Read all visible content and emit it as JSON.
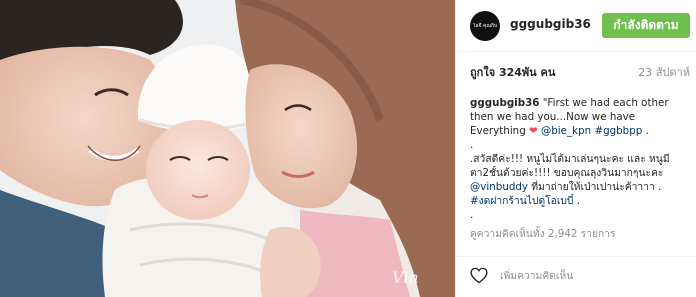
{
  "photo": {
    "alt": "Family photo with a newborn baby",
    "watermark": "Vin"
  },
  "profile": {
    "avatar_text": "ไอจี คุณกิ๊บ @gggubgib36",
    "username": "gggubgib36",
    "follow_label": "กำลังติดตาม"
  },
  "stats": {
    "likes": "ถูกใจ 324พัน คน",
    "posted": "23 สัปดาห์"
  },
  "caption": {
    "username": "gggubgib36",
    "line1_text": " \"First we had each other",
    "line2": "then we had you...Now we have",
    "line3_text": "Everything ",
    "mention1": "@bie_kpn",
    "hashtag1": "#ggbbpp",
    "line3_end": " .",
    "dot1": ".",
    "line5": ".สวัสดีค่ะ!!! หนูไม่ได้มาเล่นๆนะคะ และ หนูมี",
    "line6": "ตา2ชั้นด้วยค่ะ!!!! ขอบคุณลุงวินมากๆนะคะ",
    "mention2": "@vinbuddy",
    "line7_text": " ที่มาถ่ายให้เป่าเปาน่ะค้าาาา .",
    "hashtag2": "#งดฝากร้านไปดูโอเบบี๋",
    "line8_end": " .",
    "dot2": "."
  },
  "comments": {
    "view_all": "ดูความคิดเห็นทั้ง 2,942 รายการ"
  },
  "footer": {
    "comment_placeholder": "เพิ่มความคิดเห็น"
  },
  "colors": {
    "follow_button": "#70c050",
    "link": "#003569",
    "heart": "#ed4956",
    "muted": "#8f8f8f"
  }
}
